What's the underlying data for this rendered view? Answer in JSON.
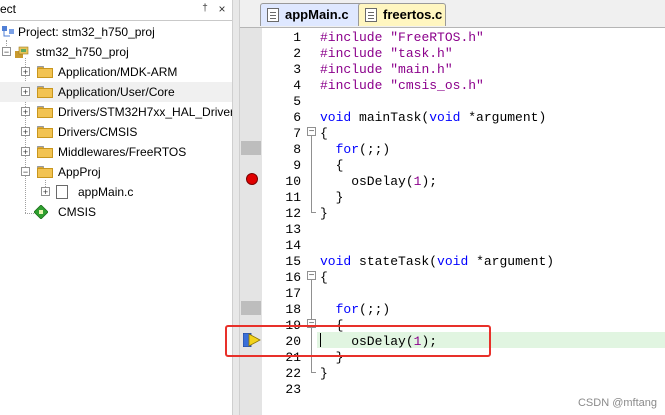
{
  "project_panel": {
    "title": "ect",
    "pin_glyph": "†",
    "close_glyph": "×",
    "tree": [
      {
        "label": "Project: stm32_h750_proj",
        "icon": "project-icon"
      },
      {
        "label": "stm32_h750_proj",
        "icon": "target-icon"
      },
      {
        "label": "Application/MDK-ARM",
        "icon": "folder-icon"
      },
      {
        "label": "Application/User/Core",
        "icon": "folder-icon"
      },
      {
        "label": "Drivers/STM32H7xx_HAL_Driver",
        "icon": "folder-icon"
      },
      {
        "label": "Drivers/CMSIS",
        "icon": "folder-icon"
      },
      {
        "label": "Middlewares/FreeRTOS",
        "icon": "folder-icon"
      },
      {
        "label": "AppProj",
        "icon": "folder-icon"
      },
      {
        "label": "appMain.c",
        "icon": "file-icon"
      },
      {
        "label": "CMSIS",
        "icon": "cmsis-component-icon"
      }
    ]
  },
  "editor": {
    "tabs": [
      {
        "label": "appMain.c",
        "active": true
      },
      {
        "label": "freertos.c",
        "active": false
      }
    ],
    "lines": [
      {
        "n": "1",
        "code": "#include \"FreeRTOS.h\""
      },
      {
        "n": "2",
        "code": "#include \"task.h\""
      },
      {
        "n": "3",
        "code": "#include \"main.h\""
      },
      {
        "n": "4",
        "code": "#include \"cmsis_os.h\""
      },
      {
        "n": "5",
        "code": ""
      },
      {
        "n": "6",
        "code": "void mainTask(void *argument)"
      },
      {
        "n": "7",
        "code": "{"
      },
      {
        "n": "8",
        "code": "  for(;;)"
      },
      {
        "n": "9",
        "code": "  {"
      },
      {
        "n": "10",
        "code": "    osDelay(1);"
      },
      {
        "n": "11",
        "code": "  }"
      },
      {
        "n": "12",
        "code": "}"
      },
      {
        "n": "13",
        "code": ""
      },
      {
        "n": "14",
        "code": ""
      },
      {
        "n": "15",
        "code": "void stateTask(void *argument)"
      },
      {
        "n": "16",
        "code": "{"
      },
      {
        "n": "17",
        "code": ""
      },
      {
        "n": "18",
        "code": "  for(;;)"
      },
      {
        "n": "19",
        "code": "  {"
      },
      {
        "n": "20",
        "code": "    osDelay(1);"
      },
      {
        "n": "21",
        "code": "  }"
      },
      {
        "n": "22",
        "code": "}"
      },
      {
        "n": "23",
        "code": ""
      }
    ],
    "current_line": 20,
    "breakpoint_line": 10
  },
  "watermark": "CSDN @mftang",
  "colors": {
    "keyword": "#0000ff",
    "preprocessor": "#8b008b",
    "breakpoint": "#e00000",
    "current_line_bg": "#e1f5e1",
    "highlight_box": "#e8302a"
  }
}
